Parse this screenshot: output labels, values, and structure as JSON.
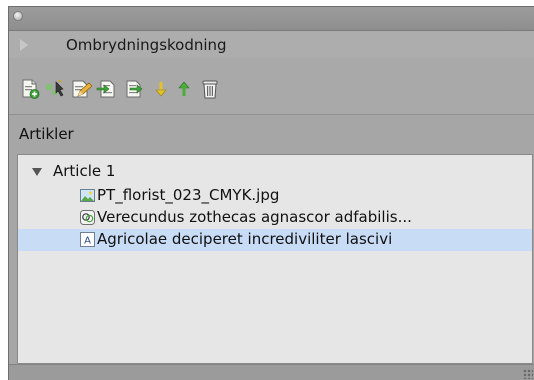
{
  "panel": {
    "section_title": "Ombrydningskodning",
    "list_header": "Artikler"
  },
  "toolbar": {
    "buttons": [
      {
        "icon": "new-document-icon"
      },
      {
        "icon": "add-to-article-icon"
      },
      {
        "icon": "edit-article-icon"
      },
      {
        "icon": "import-icon"
      },
      {
        "icon": "export-icon"
      },
      {
        "icon": "move-down-icon"
      },
      {
        "icon": "move-up-icon"
      },
      {
        "icon": "trash-icon"
      }
    ]
  },
  "tree": {
    "article": {
      "label": "Article 1",
      "expanded": true
    },
    "items": [
      {
        "label": "PT_florist_023_CMYK.jpg",
        "icon": "image-file-icon",
        "selected": false
      },
      {
        "label": "Verecundus zothecas agnascor adfabilis...",
        "icon": "linked-story-icon",
        "selected": false
      },
      {
        "label": "Agricolae deciperet incrediviliter lascivi",
        "icon": "text-frame-icon",
        "selected": true
      }
    ]
  },
  "colors": {
    "selection": "#c9dcf5",
    "panel_bg": "#a6a6a6",
    "list_bg": "#e6e6e6"
  }
}
